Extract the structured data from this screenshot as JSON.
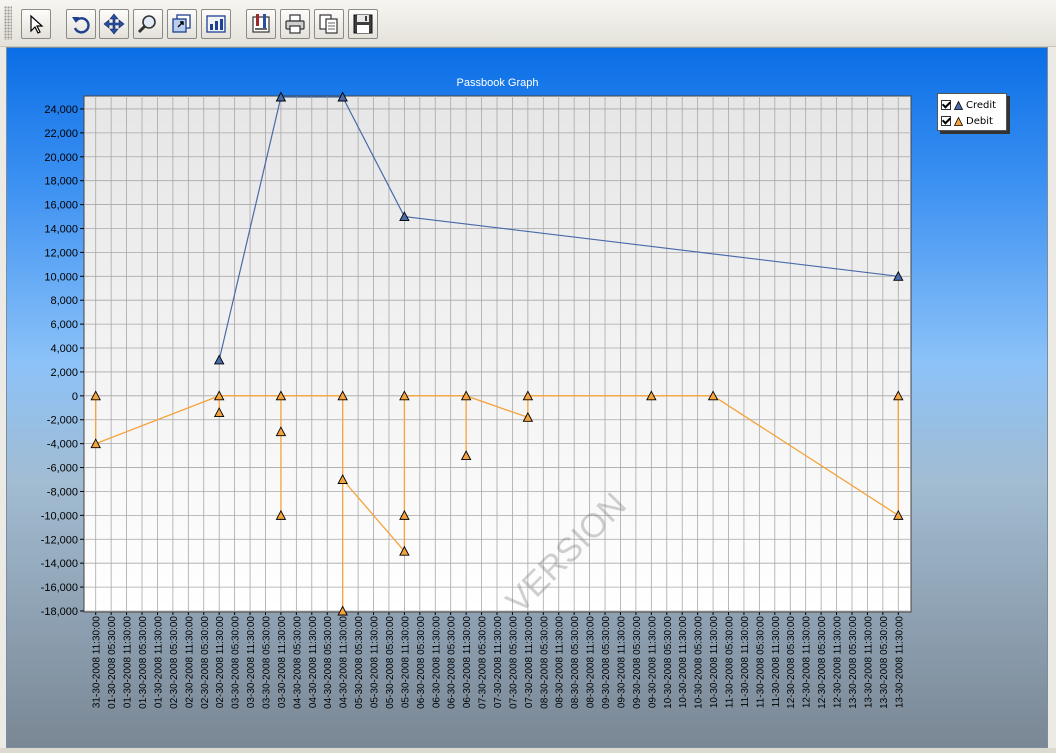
{
  "toolbar": {
    "buttons": [
      {
        "name": "select-arrow-button",
        "icon": "arrow-pointer-icon"
      },
      {
        "name": "undo-button",
        "icon": "undo-icon"
      },
      {
        "name": "pan-button",
        "icon": "move-icon"
      },
      {
        "name": "zoom-button",
        "icon": "magnifier-icon"
      },
      {
        "name": "zoom-out-button",
        "icon": "zoom-out-icon"
      },
      {
        "name": "chart-type-button",
        "icon": "chart-icon"
      },
      {
        "name": "properties-button",
        "icon": "properties-icon"
      },
      {
        "name": "print-button",
        "icon": "printer-icon"
      },
      {
        "name": "copy-button",
        "icon": "copy-icon"
      },
      {
        "name": "save-button",
        "icon": "floppy-disk-icon"
      }
    ]
  },
  "colors": {
    "credit": "#4a6aa8",
    "debit": "#f5a33c",
    "grid": "#a8a8a8"
  },
  "chart_data": {
    "type": "line",
    "title": "Passbook Graph",
    "xlabel": "",
    "ylabel": "",
    "ylim": [
      -18000,
      25000
    ],
    "yticks": [
      24000,
      22000,
      20000,
      18000,
      16000,
      14000,
      12000,
      10000,
      8000,
      6000,
      4000,
      2000,
      0,
      -2000,
      -4000,
      -6000,
      -8000,
      -10000,
      -12000,
      -14000,
      -16000,
      -18000
    ],
    "grid": true,
    "legend_position": "right",
    "watermark": "VERSION",
    "categories": [
      "31-30-2008 11:30:00",
      "01-30-2008 05:30:00",
      "01-30-2008 11:30:00",
      "01-30-2008 05:30:00",
      "01-30-2008 11:30:00",
      "02-30-2008 05:30:00",
      "02-30-2008 11:30:00",
      "02-30-2008 05:30:00",
      "02-30-2008 11:30:00",
      "03-30-2008 05:30:00",
      "03-30-2008 11:30:00",
      "03-30-2008 05:30:00",
      "03-30-2008 11:30:00",
      "04-30-2008 05:30:00",
      "04-30-2008 11:30:00",
      "04-30-2008 05:30:00",
      "04-30-2008 11:30:00",
      "05-30-2008 05:30:00",
      "05-30-2008 11:30:00",
      "05-30-2008 05:30:00",
      "05-30-2008 11:30:00",
      "06-30-2008 05:30:00",
      "06-30-2008 11:30:00",
      "06-30-2008 05:30:00",
      "06-30-2008 11:30:00",
      "07-30-2008 05:30:00",
      "07-30-2008 11:30:00",
      "07-30-2008 05:30:00",
      "07-30-2008 11:30:00",
      "08-30-2008 05:30:00",
      "08-30-2008 11:30:00",
      "08-30-2008 05:30:00",
      "08-30-2008 11:30:00",
      "09-30-2008 05:30:00",
      "09-30-2008 11:30:00",
      "09-30-2008 05:30:00",
      "09-30-2008 11:30:00",
      "10-30-2008 05:30:00",
      "10-30-2008 11:30:00",
      "10-30-2008 05:30:00",
      "10-30-2008 11:30:00",
      "11-30-2008 05:30:00",
      "11-30-2008 11:30:00",
      "11-30-2008 05:30:00",
      "11-30-2008 11:30:00",
      "12-30-2008 05:30:00",
      "12-30-2008 11:30:00",
      "12-30-2008 05:30:00",
      "12-30-2008 11:30:00",
      "13-30-2008 05:30:00",
      "13-30-2008 11:30:00",
      "13-30-2008 05:30:00",
      "13-30-2008 11:30:00"
    ],
    "series": [
      {
        "name": "Credit",
        "points": [
          {
            "x": 8,
            "y": 3000
          },
          {
            "x": 12,
            "y": 25000
          },
          {
            "x": 16,
            "y": 25000
          },
          {
            "x": 20,
            "y": 15000
          },
          {
            "x": 52,
            "y": 10000
          }
        ]
      },
      {
        "name": "Debit",
        "points": [
          {
            "x": 0,
            "y": 0
          },
          {
            "x": 0,
            "y": -4000
          },
          {
            "x": 8,
            "y": 0
          },
          {
            "x": 8,
            "y": -1400
          },
          {
            "x": 12,
            "y": 0
          },
          {
            "x": 12,
            "y": -3000
          },
          {
            "x": 12,
            "y": -10000
          },
          {
            "x": 16,
            "y": 0
          },
          {
            "x": 16,
            "y": -7000
          },
          {
            "x": 16,
            "y": -18000
          },
          {
            "x": 20,
            "y": 0
          },
          {
            "x": 20,
            "y": -10000
          },
          {
            "x": 20,
            "y": -13000
          },
          {
            "x": 24,
            "y": 0
          },
          {
            "x": 24,
            "y": -5000
          },
          {
            "x": 28,
            "y": 0
          },
          {
            "x": 28,
            "y": -1800
          },
          {
            "x": 36,
            "y": 0
          },
          {
            "x": 40,
            "y": 0
          },
          {
            "x": 52,
            "y": 0
          },
          {
            "x": 52,
            "y": -10000
          }
        ],
        "path": [
          {
            "x": 0,
            "y": 0
          },
          {
            "x": 0,
            "y": -4000
          },
          {
            "x": 8,
            "y": 0
          },
          {
            "x": 8,
            "y": -1400
          },
          {
            "x": 8,
            "y": 0
          },
          {
            "x": 12,
            "y": 0
          },
          {
            "x": 12,
            "y": -10000
          },
          {
            "x": 12,
            "y": 0
          },
          {
            "x": 16,
            "y": 0
          },
          {
            "x": 16,
            "y": -18000
          },
          {
            "x": 16,
            "y": -7000
          },
          {
            "x": 20,
            "y": -13000
          },
          {
            "x": 20,
            "y": 0
          },
          {
            "x": 24,
            "y": 0
          },
          {
            "x": 24,
            "y": -5000
          },
          {
            "x": 24,
            "y": 0
          },
          {
            "x": 28,
            "y": -1800
          },
          {
            "x": 28,
            "y": 0
          },
          {
            "x": 40,
            "y": 0
          },
          {
            "x": 52,
            "y": -10000
          },
          {
            "x": 52,
            "y": 0
          }
        ]
      }
    ]
  }
}
